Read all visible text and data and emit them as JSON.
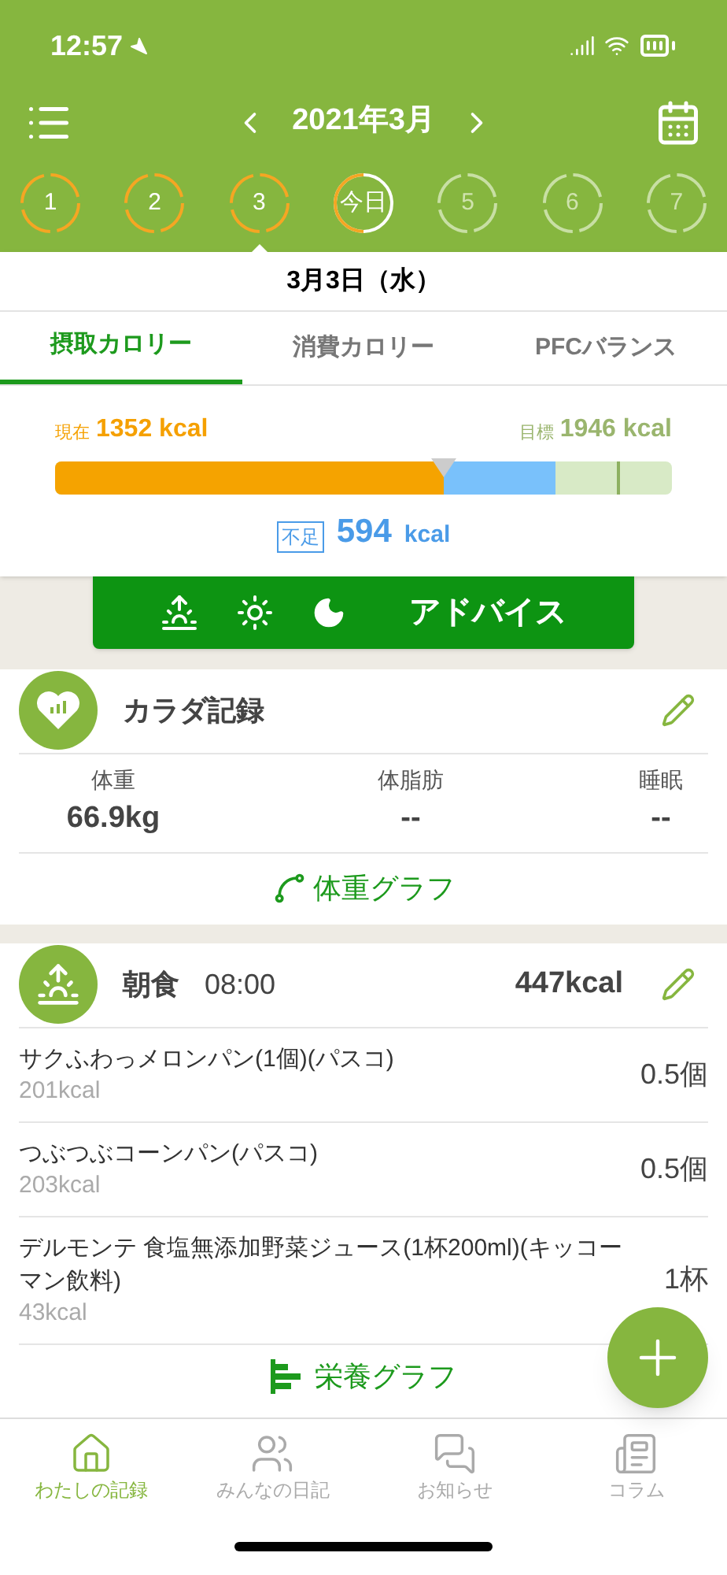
{
  "status_bar": {
    "time": "12:57"
  },
  "header": {
    "month": "2021年3月"
  },
  "days": [
    {
      "label": "1",
      "kind": "past",
      "selected": false
    },
    {
      "label": "2",
      "kind": "past",
      "selected": false
    },
    {
      "label": "3",
      "kind": "past",
      "selected": true
    },
    {
      "label": "今日",
      "kind": "today",
      "selected": false
    },
    {
      "label": "5",
      "kind": "future",
      "selected": false
    },
    {
      "label": "6",
      "kind": "future",
      "selected": false
    },
    {
      "label": "7",
      "kind": "future",
      "selected": false
    }
  ],
  "date_title": "3月3日（水）",
  "tabs": [
    {
      "label": "摂取カロリー",
      "selected": true
    },
    {
      "label": "消費カロリー",
      "selected": false
    },
    {
      "label": "PFCバランス",
      "selected": false
    }
  ],
  "calories": {
    "current_label": "現在",
    "current_value": "1352",
    "current_unit": "kcal",
    "target_label": "目標",
    "target_value": "1946",
    "target_unit": "kcal",
    "segments": [
      {
        "kind": "current",
        "level": 0.63
      },
      {
        "kind": "target",
        "level": 0.91
      }
    ],
    "shortfall_badge": "不足",
    "shortfall_value": "594",
    "shortfall_unit": "kcal"
  },
  "advice_button": {
    "label": "アドバイス"
  },
  "body_record": {
    "title": "カラダ記録",
    "metrics": [
      {
        "label": "体重",
        "value": "66.9kg"
      },
      {
        "label": "体脂肪",
        "value": "--"
      },
      {
        "label": "睡眠",
        "value": "--"
      }
    ],
    "graph_link": "体重グラフ"
  },
  "meal": {
    "title": "朝食",
    "time": "08:00",
    "total": "447kcal",
    "items": [
      {
        "name": "サクふわっメロンパン(1個)(パスコ)",
        "kcal": "201kcal",
        "amount": "0.5個"
      },
      {
        "name": "つぶつぶコーンパン(パスコ)",
        "kcal": "203kcal",
        "amount": "0.5個"
      },
      {
        "name": "デルモンテ 食塩無添加野菜ジュース(1杯200ml)(キッコーマン飲料)",
        "kcal": "43kcal",
        "amount": "1杯"
      }
    ],
    "graph_link": "栄養グラフ"
  },
  "bottom_nav": [
    {
      "label": "わたしの記録",
      "selected": true
    },
    {
      "label": "みんなの日記",
      "selected": false
    },
    {
      "label": "お知らせ",
      "selected": false
    },
    {
      "label": "コラム",
      "selected": false
    }
  ]
}
